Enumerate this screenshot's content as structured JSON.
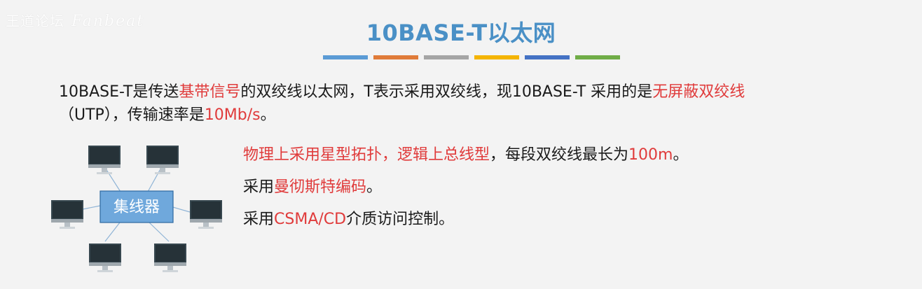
{
  "watermark": {
    "brand": "王道论坛",
    "script": "Fanbeat"
  },
  "slide": {
    "title": "10BASE-T以太网",
    "title_bar_colors": [
      "#5b9bd5",
      "#e07b39",
      "#a5a5a5",
      "#f4b400",
      "#4472c4",
      "#70ad47"
    ]
  },
  "intro": {
    "p1": "10BASE-T是传送",
    "p2": "基带信号",
    "p3": "的双绞线以太网，T表示采用双绞线，现10BASE-T 采用的是",
    "p4": "无屏蔽双绞线",
    "p5": "（UTP），传输速率是",
    "p6": "10Mb/s",
    "p7": "。"
  },
  "points": [
    {
      "a": "物理上采用星型拓扑，逻辑上总线型",
      "b": "，每段双绞线最长为",
      "c": "100m",
      "d": "。"
    },
    {
      "a": "采用",
      "b": "曼彻斯特编码",
      "c": "。"
    },
    {
      "a": "采用",
      "b": "CSMA/CD",
      "c": "介质访问控制。"
    }
  ],
  "diagram": {
    "hub_label": "集线器"
  },
  "colors": {
    "title": "#4a90c6",
    "highlight": "#e03b3b",
    "hub_fill": "#6fa8dc"
  }
}
